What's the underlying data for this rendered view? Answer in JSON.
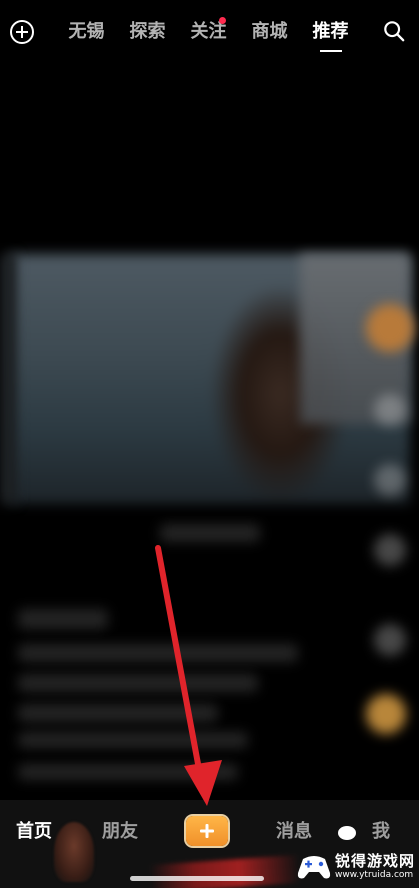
{
  "top_nav": {
    "tabs": [
      {
        "label": "无锡"
      },
      {
        "label": "探索"
      },
      {
        "label": "关注"
      },
      {
        "label": "商城"
      },
      {
        "label": "推荐"
      }
    ],
    "active_tab": "推荐",
    "dot_color": "#ff2b4f"
  },
  "bottom_nav": {
    "home": "首页",
    "friends": "朋友",
    "messages": "消息",
    "me": "我",
    "post_button_color": "#f0902a"
  },
  "annotation": {
    "arrow_color": "#e0242b"
  },
  "watermark": {
    "title": "锐得游戏网",
    "url": "www.ytruida.com"
  }
}
